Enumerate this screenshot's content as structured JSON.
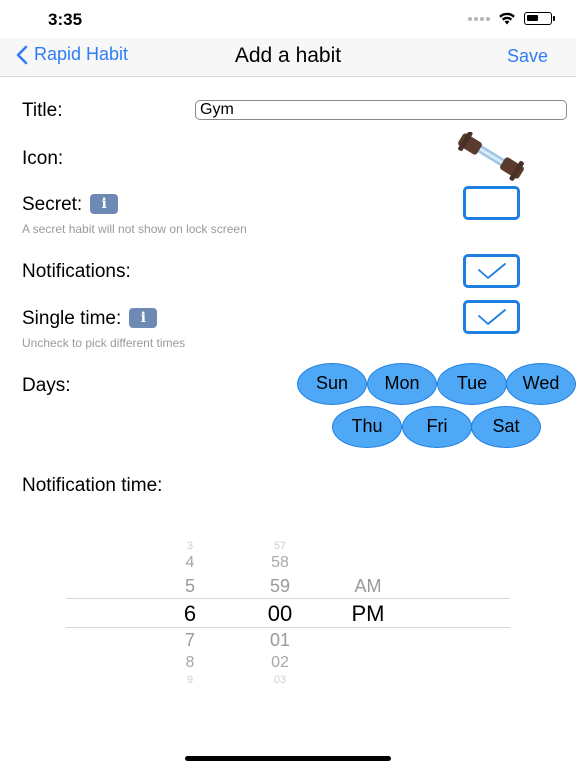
{
  "status": {
    "time": "3:35"
  },
  "nav": {
    "back_label": "Rapid Habit",
    "title": "Add a habit",
    "save_label": "Save"
  },
  "form": {
    "title_label": "Title:",
    "title_value": "Gym",
    "icon_label": "Icon:",
    "icon_name": "weight-lifting-dumbbell-icon",
    "secret_label": "Secret:",
    "secret_hint": "A secret habit will not show on lock screen",
    "secret_checked": false,
    "notifications_label": "Notifications:",
    "notifications_checked": true,
    "single_time_label": "Single time:",
    "single_time_hint": "Uncheck to pick different times",
    "single_time_checked": true,
    "info_glyph": "i",
    "days_label": "Days:",
    "days": [
      "Sun",
      "Mon",
      "Tue",
      "Wed",
      "Thu",
      "Fri",
      "Sat"
    ],
    "notification_time_label": "Notification time:"
  },
  "time_picker": {
    "hours": [
      "3",
      "4",
      "5",
      "6",
      "7",
      "8",
      "9"
    ],
    "minutes": [
      "57",
      "58",
      "59",
      "00",
      "01",
      "02",
      "03"
    ],
    "periods": [
      "AM",
      "PM"
    ],
    "selected_hour": "6",
    "selected_minute": "00",
    "selected_period": "PM"
  },
  "colors": {
    "accent": "#2f7df6",
    "day_fill": "#4ea8f5",
    "checkbox_border": "#1f7fe0"
  }
}
